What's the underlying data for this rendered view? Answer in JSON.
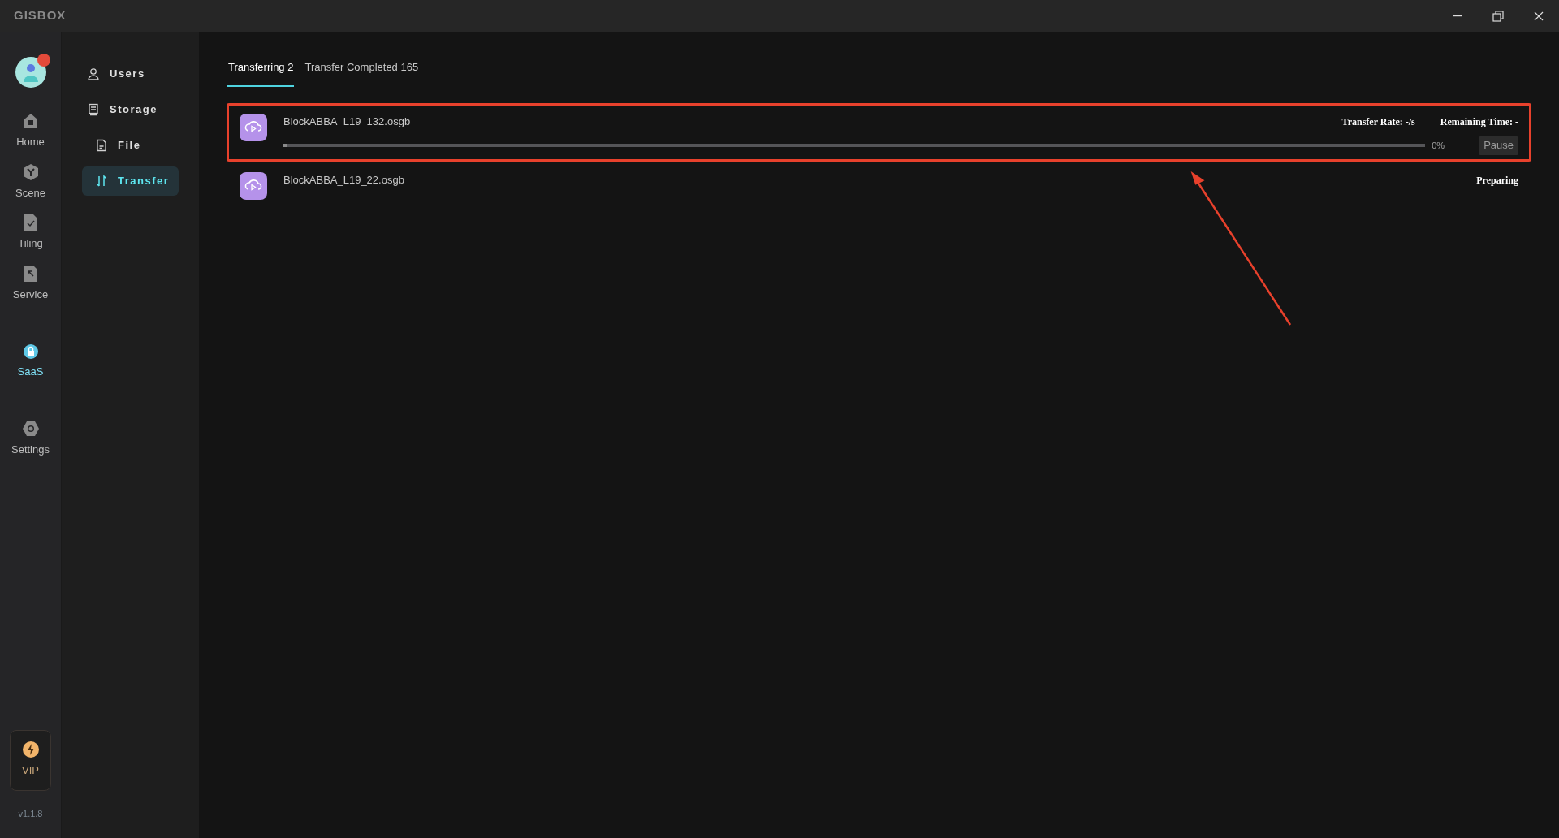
{
  "window": {
    "logo": "GISBOX"
  },
  "rail": {
    "items": [
      {
        "label": "Home",
        "selected": false
      },
      {
        "label": "Scene",
        "selected": false
      },
      {
        "label": "Tiling",
        "selected": false
      },
      {
        "label": "Service",
        "selected": false
      },
      {
        "label": "SaaS",
        "selected": true
      },
      {
        "label": "Settings",
        "selected": false
      }
    ],
    "vip": "VIP",
    "version": "v1.1.8"
  },
  "sidebar": {
    "items": [
      {
        "label": "Users",
        "selected": false
      },
      {
        "label": "Storage",
        "selected": false,
        "children": [
          {
            "label": "File",
            "selected": false
          },
          {
            "label": "Transfer",
            "selected": true
          }
        ]
      }
    ]
  },
  "tabs": [
    {
      "label": "Transferring 2",
      "selected": true
    },
    {
      "label": "Transfer Completed 165",
      "selected": false
    }
  ],
  "transfers": [
    {
      "kind": "active",
      "name": "BlockABBA_L19_132.osgb",
      "rate": "Transfer Rate: -/s",
      "remaining": "Remaining Time: -",
      "level": 0,
      "percent": "0%",
      "button": "Pause",
      "highlighted": true
    },
    {
      "kind": "waiting",
      "name": "BlockABBA_L19_22.osgb",
      "status": "Preparing",
      "highlighted": false
    }
  ]
}
